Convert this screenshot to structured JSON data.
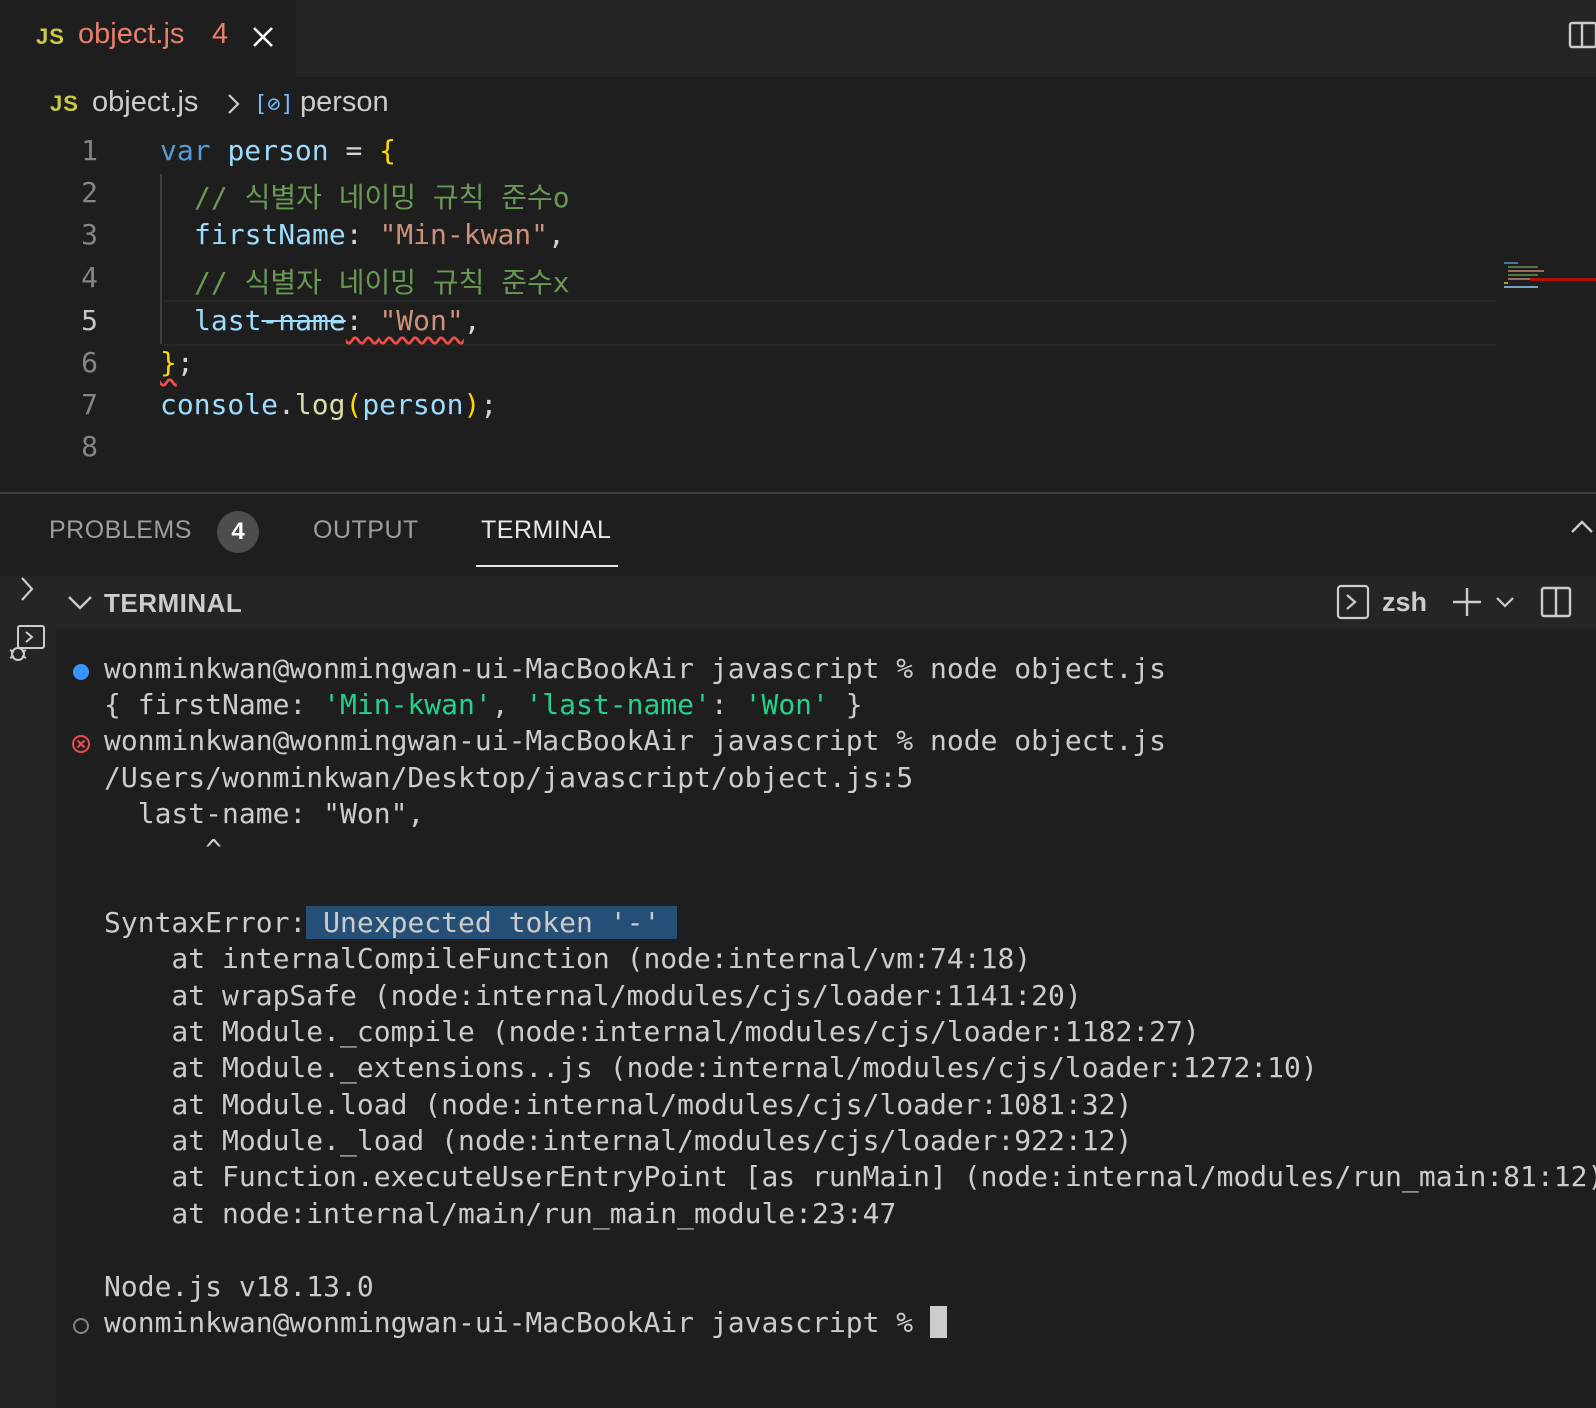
{
  "tab": {
    "lang_badge": "JS",
    "filename": "object.js",
    "problem_count": "4"
  },
  "breadcrumb": {
    "lang_badge": "JS",
    "file": "object.js",
    "symbol_icon": "[⊘]",
    "symbol": "person"
  },
  "editor": {
    "line_numbers": [
      "1",
      "2",
      "3",
      "4",
      "5",
      "6",
      "7",
      "8"
    ],
    "active_line": 5,
    "code": {
      "l1": {
        "kw": "var",
        "name": "person",
        "op": " = ",
        "brace": "{"
      },
      "l2": {
        "comment": "// 식별자 네이밍 규칙 준수o"
      },
      "l3": {
        "key": "firstName",
        "colon": ": ",
        "value": "\"Min-kwan\"",
        "comma": ","
      },
      "l4": {
        "comment": "// 식별자 네이밍 규칙 준수x"
      },
      "l5": {
        "key_a": "last",
        "key_b": "-",
        "key_c": "name",
        "colon": ": ",
        "value": "\"Won\"",
        "comma": ","
      },
      "l6": {
        "brace": "}",
        "semi": ";"
      },
      "l7": {
        "obj": "console",
        "dot": ".",
        "fn": "log",
        "po": "(",
        "arg": "person",
        "pc": ")",
        "semi": ";"
      }
    }
  },
  "panel": {
    "tabs": {
      "problems": "PROBLEMS",
      "problems_badge": "4",
      "output": "OUTPUT",
      "terminal": "TERMINAL"
    },
    "terminal_header": {
      "title": "TERMINAL",
      "shell": "zsh"
    }
  },
  "terminal": {
    "l1": "wonminkwan@wonmingwan-ui-MacBookAir javascript % node object.js",
    "l2": {
      "a": "{ firstName: ",
      "b": "'Min-kwan'",
      "c": ", ",
      "d": "'last-name'",
      "e": ": ",
      "f": "'Won'",
      "g": " }"
    },
    "l3": "wonminkwan@wonmingwan-ui-MacBookAir javascript % node object.js",
    "l4": "/Users/wonminkwan/Desktop/javascript/object.js:5",
    "l5": "  last-name: \"Won\",",
    "l6": "      ^",
    "l7": {
      "prefix": "SyntaxError:",
      "highlight": " Unexpected token '-' "
    },
    "stack": [
      "    at internalCompileFunction (node:internal/vm:74:18)",
      "    at wrapSafe (node:internal/modules/cjs/loader:1141:20)",
      "    at Module._compile (node:internal/modules/cjs/loader:1182:27)",
      "    at Module._extensions..js (node:internal/modules/cjs/loader:1272:10)",
      "    at Module.load (node:internal/modules/cjs/loader:1081:32)",
      "    at Module._load (node:internal/modules/cjs/loader:922:12)",
      "    at Function.executeUserEntryPoint [as runMain] (node:internal/modules/run_main:81:12)",
      "    at node:internal/main/run_main_module:23:47"
    ],
    "node_version": "Node.js v18.13.0",
    "prompt": "wonminkwan@wonmingwan-ui-MacBookAir javascript % "
  },
  "colors": {
    "success_dot": "#3794ff",
    "error_dot": "#f14c4c",
    "idle_dot": "#848484",
    "string_green": "#23d18b",
    "selection": "#264f78"
  }
}
